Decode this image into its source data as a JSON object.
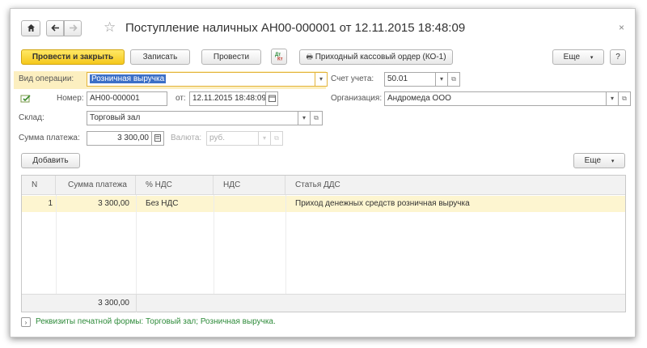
{
  "title": "Поступление наличных АН00-000001 от 12.11.2015 18:48:09",
  "window_close": "×",
  "toolbar": {
    "post_close": "Провести и закрыть",
    "save": "Записать",
    "post": "Провести",
    "print_order": "Приходный кассовый ордер (КО-1)",
    "more": "Еще",
    "help": "?"
  },
  "form": {
    "operation_label": "Вид операции:",
    "operation_value": "Розничная выручка",
    "account_label": "Счет учета:",
    "account_value": "50.01",
    "number_label": "Номер:",
    "number_value": "АН00-000001",
    "date_label": "от:",
    "date_value": "12.11.2015 18:48:09",
    "org_label": "Организация:",
    "org_value": "Андромеда ООО",
    "warehouse_label": "Склад:",
    "warehouse_value": "Торговый зал",
    "sum_label": "Сумма платежа:",
    "sum_value": "3 300,00",
    "currency_label": "Валюта:",
    "currency_value": "руб."
  },
  "table_toolbar": {
    "add": "Добавить",
    "more": "Еще"
  },
  "table": {
    "columns": [
      "N",
      "Сумма платежа",
      "% НДС",
      "НДС",
      "Статья ДДС"
    ],
    "rows": [
      {
        "n": "1",
        "sum": "3 300,00",
        "vat_rate": "Без НДС",
        "vat": "",
        "item": "Приход денежных средств розничная выручка"
      }
    ],
    "total_sum": "3 300,00"
  },
  "footer": {
    "print_requisites": "Реквизиты печатной формы: Торговый зал; Розничная выручка."
  },
  "colors": {
    "accent_yellow": "#f5c81c",
    "selected_row": "#fdf5d0",
    "link_green": "#2e8b3a"
  }
}
